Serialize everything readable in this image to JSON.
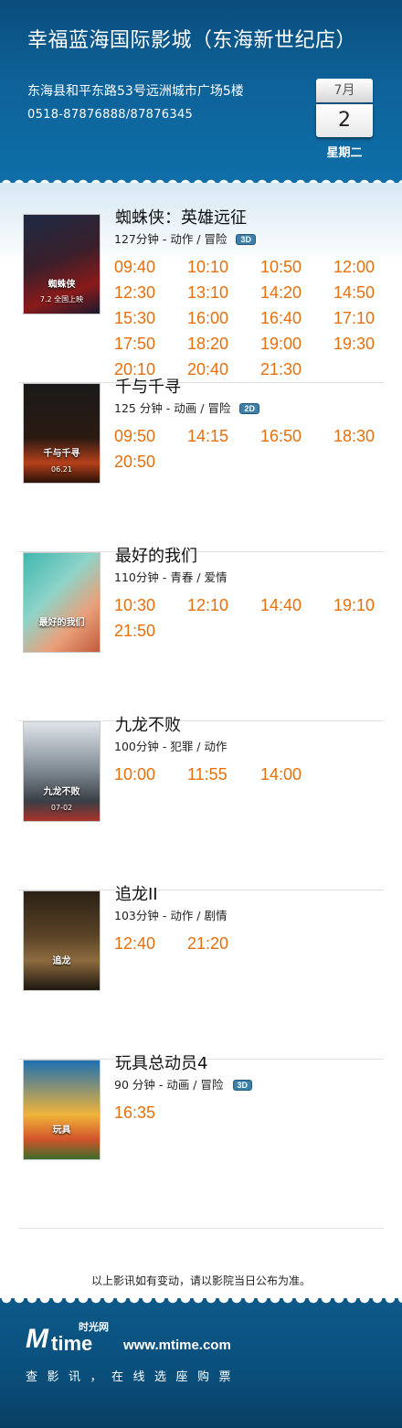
{
  "header": {
    "cinema_name": "幸福蓝海国际影城（东海新世纪店）",
    "address": "东海县和平东路53号远洲城市广场5楼",
    "phone": "0518-87876888/87876345",
    "calendar": {
      "month": "7月",
      "day": "2",
      "weekday": "星期二"
    }
  },
  "colors": {
    "header_blue": "#0d6299",
    "showtime_orange": "#e86f0a",
    "badge_blue": "#3d7fa8"
  },
  "movies": [
    {
      "title": "蜘蛛侠：英雄远征",
      "meta": "127分钟 - 动作 / 冒险",
      "format": "3D",
      "poster_text": "蜘蛛侠",
      "poster_date": "7.2 全国上映",
      "times": [
        "09:40",
        "10:10",
        "10:50",
        "12:00",
        "12:30",
        "13:10",
        "14:20",
        "14:50",
        "15:30",
        "16:00",
        "16:40",
        "17:10",
        "17:50",
        "18:20",
        "19:00",
        "19:30",
        "20:10",
        "20:40",
        "21:30"
      ]
    },
    {
      "title": "千与千寻",
      "meta": "125 分钟 - 动画 / 冒险",
      "format": "2D",
      "poster_text": "千与千寻",
      "poster_date": "06.21",
      "times": [
        "09:50",
        "14:15",
        "16:50",
        "18:30",
        "20:50"
      ]
    },
    {
      "title": "最好的我们",
      "meta": "110分钟 - 青春 / 爱情",
      "format": "",
      "poster_text": "最好的我们",
      "poster_date": "",
      "times": [
        "10:30",
        "12:10",
        "14:40",
        "19:10",
        "21:50"
      ]
    },
    {
      "title": "九龙不败",
      "meta": "100分钟 - 犯罪 / 动作",
      "format": "",
      "poster_text": "九龙不败",
      "poster_date": "07-02",
      "times": [
        "10:00",
        "11:55",
        "14:00"
      ]
    },
    {
      "title": "追龙II",
      "meta": "103分钟 - 动作 / 剧情",
      "format": "",
      "poster_text": "追龙",
      "poster_date": "",
      "times": [
        "12:40",
        "21:20"
      ]
    },
    {
      "title": "玩具总动员4",
      "meta": "90 分钟 - 动画 / 冒险",
      "format": "3D",
      "poster_text": "玩具",
      "poster_date": "",
      "times": [
        "16:35"
      ]
    }
  ],
  "notice": "以上影讯如有变动，请以影院当日公布为准。",
  "footer": {
    "logo_m": "M",
    "logo_time": "time",
    "logo_cn": "时光网",
    "url": "www.mtime.com",
    "slogan": "查影讯，在线选座购票"
  }
}
